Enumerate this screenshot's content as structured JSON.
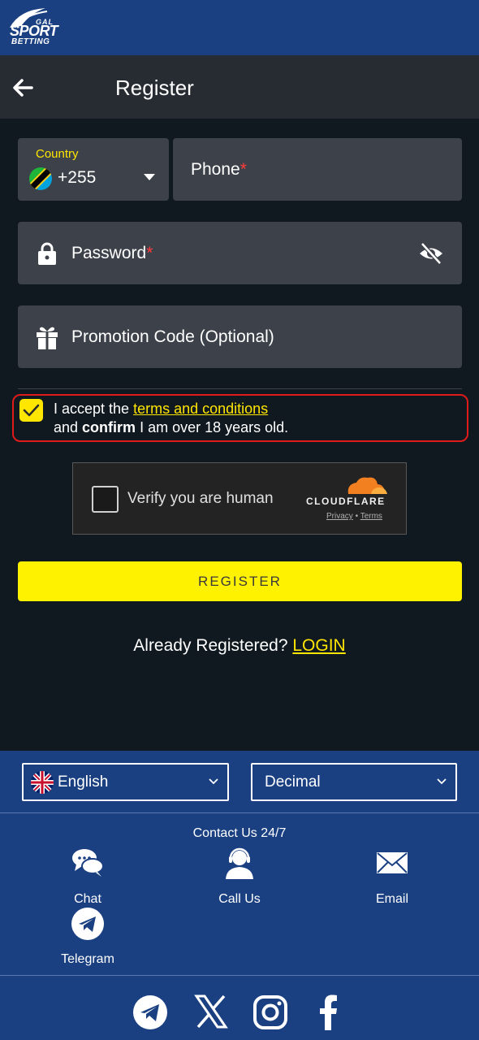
{
  "brand": {
    "logo_top": "GAL",
    "logo_mid": "SPORT",
    "logo_bottom": "BETTING"
  },
  "header": {
    "title": "Register",
    "back_icon": "arrow-left-icon"
  },
  "form": {
    "country": {
      "label": "Country",
      "code": "+255",
      "flag": "tanzania-flag-icon"
    },
    "phone": {
      "placeholder": "Phone",
      "required_mark": "*"
    },
    "password": {
      "placeholder": "Password",
      "required_mark": "*",
      "icon": "lock-icon",
      "toggle_icon": "eye-off-icon"
    },
    "promo": {
      "placeholder": "Promotion Code (Optional)",
      "icon": "gift-icon"
    },
    "terms": {
      "checked": true,
      "prefix": "I accept the ",
      "link_text": "terms and conditions",
      "line2_prefix": "and ",
      "line2_bold": "confirm",
      "line2_suffix": " I am over 18 years old."
    },
    "captcha": {
      "text": "Verify you are human",
      "provider": "CLOUDFLARE",
      "privacy": "Privacy",
      "separator": "•",
      "terms": "Terms"
    },
    "register_button": "REGISTER",
    "login_prompt": "Already Registered? ",
    "login_link": "LOGIN"
  },
  "footer": {
    "language": "English",
    "odds_format": "Decimal",
    "contact_title": "Contact Us 24/7",
    "contacts": [
      {
        "label": "Chat",
        "icon": "chat-icon"
      },
      {
        "label": "Call Us",
        "icon": "support-agent-icon"
      },
      {
        "label": "Email",
        "icon": "email-icon"
      },
      {
        "label": "Telegram",
        "icon": "telegram-icon"
      }
    ],
    "social": [
      "telegram-icon",
      "x-icon",
      "instagram-icon",
      "facebook-icon"
    ]
  },
  "colors": {
    "accent": "#ffe600",
    "header_blue": "#1a4082",
    "background": "#101820",
    "field": "#3d424a",
    "error": "#e01b1b"
  }
}
